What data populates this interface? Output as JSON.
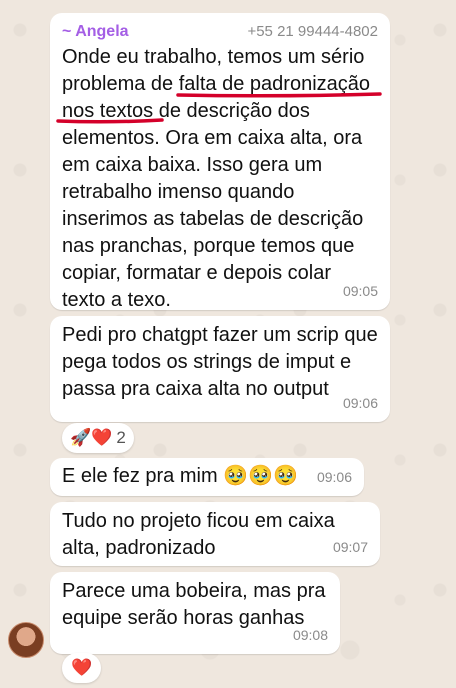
{
  "messages": [
    {
      "sender_name": "~ Angela",
      "sender_phone": "+55 21 99444-4802",
      "text_before": "Onde eu trabalho, temos um sério problema de ",
      "highlight_1": "falta de padronização",
      "text_space": " ",
      "highlight_2": "nos textos",
      "text_after": " de descrição dos elementos. Ora em caixa alta, ora em caixa baixa. Isso gera um retrabalho imenso quando inserimos as tabelas de descrição nas pranchas, porque temos que copiar, formatar e depois colar texto a texo.",
      "time": "09:05"
    },
    {
      "text": "Pedi pro chatgpt fazer um scrip que pega todos os strings de imput e passa pra caixa alta no output",
      "time": "09:06",
      "reactions": {
        "emojis": "🚀❤️",
        "count": "2"
      }
    },
    {
      "text": "E ele fez pra mim 🥹🥹🥹",
      "time": "09:06"
    },
    {
      "text": "Tudo no projeto ficou em caixa alta, padronizado",
      "time": "09:07"
    },
    {
      "text_before": "Parece uma bobeira, ",
      "highlight": "mas pra equipe serão horas ganhas",
      "time": "09:08",
      "reactions": {
        "emojis": "❤️"
      }
    }
  ],
  "colors": {
    "sender_name": "#a45ee5",
    "underline": "#d4002a",
    "bubble": "#ffffff",
    "background": "#efe7de"
  }
}
